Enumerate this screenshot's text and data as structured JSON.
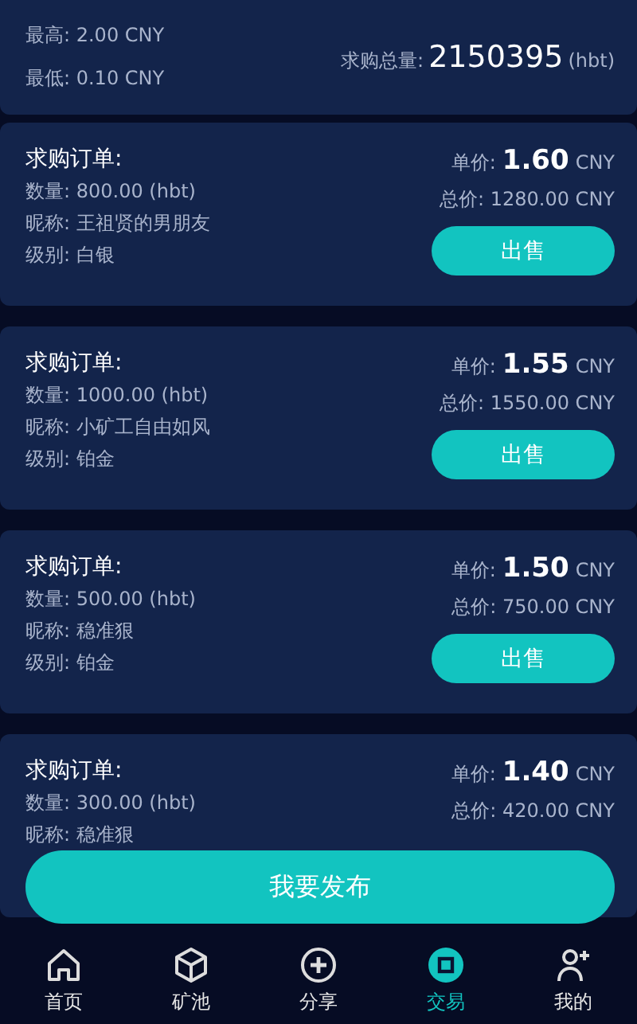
{
  "summary": {
    "high": "最高: 2.00 CNY",
    "low": "最低: 0.10 CNY",
    "total_label": "求购总量:",
    "total_value": "2150395",
    "total_unit": "(hbt)"
  },
  "orders": [
    {
      "title": "求购订单:",
      "quantity": "数量: 800.00 (hbt)",
      "nickname": "昵称: 王祖贤的男朋友",
      "level": "级别: 白银",
      "price_label": "单价:",
      "price": "1.60",
      "price_unit": "CNY",
      "total": "总价: 1280.00 CNY",
      "button": "出售"
    },
    {
      "title": "求购订单:",
      "quantity": "数量: 1000.00 (hbt)",
      "nickname": "昵称: 小矿工自由如风",
      "level": "级别: 铂金",
      "price_label": "单价:",
      "price": "1.55",
      "price_unit": "CNY",
      "total": "总价: 1550.00 CNY",
      "button": "出售"
    },
    {
      "title": "求购订单:",
      "quantity": "数量: 500.00 (hbt)",
      "nickname": "昵称: 稳准狠",
      "level": "级别: 铂金",
      "price_label": "单价:",
      "price": "1.50",
      "price_unit": "CNY",
      "total": "总价: 750.00 CNY",
      "button": "出售"
    },
    {
      "title": "求购订单:",
      "quantity": "数量: 300.00 (hbt)",
      "nickname": "昵称: 稳准狠",
      "price_label": "单价:",
      "price": "1.40",
      "price_unit": "CNY",
      "total": "总价: 420.00 CNY"
    }
  ],
  "publish_button": "我要发布",
  "nav": [
    {
      "kind": "home",
      "label": "首页",
      "selected": false
    },
    {
      "kind": "cube",
      "label": "矿池",
      "selected": false
    },
    {
      "kind": "plus",
      "label": "分享",
      "selected": false
    },
    {
      "kind": "trade",
      "label": "交易",
      "selected": true
    },
    {
      "kind": "user",
      "label": "我的",
      "selected": false
    }
  ]
}
